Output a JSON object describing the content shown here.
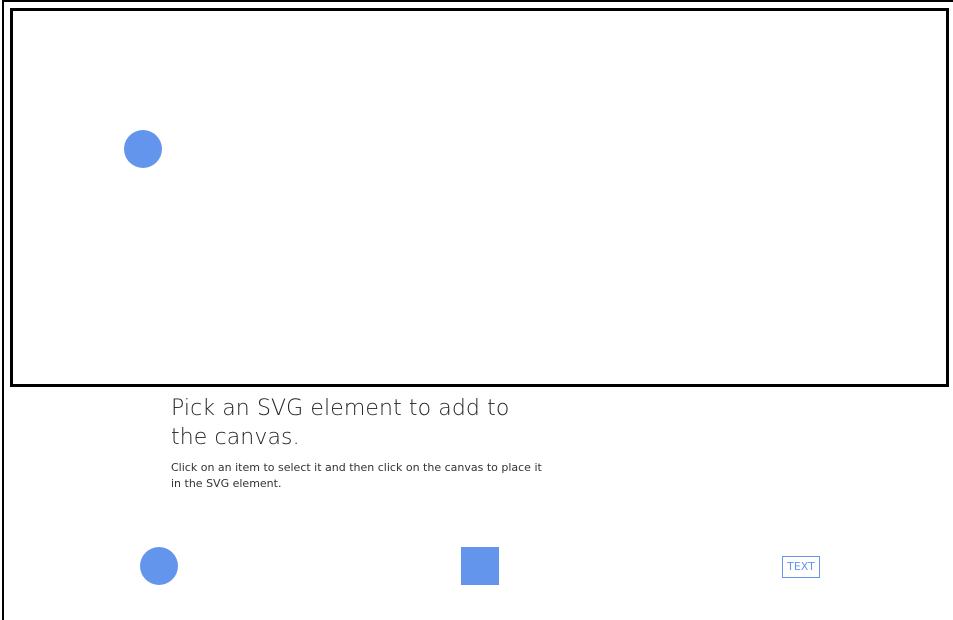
{
  "colors": {
    "shape_fill": "#6495ed",
    "canvas_border": "#000000",
    "text_item": "#6495ed"
  },
  "canvas": {
    "placed_elements": [
      {
        "type": "circle",
        "icon": "circle-shape"
      }
    ]
  },
  "instructions": {
    "heading": "Pick an SVG element to add to the canvas.",
    "description": "Click on an item to select it and then click on the canvas to place it in the SVG element."
  },
  "palette": {
    "items": [
      {
        "type": "circle",
        "icon": "circle-shape"
      },
      {
        "type": "rect",
        "icon": "square-shape"
      },
      {
        "type": "text",
        "label": "TEXT"
      }
    ]
  }
}
